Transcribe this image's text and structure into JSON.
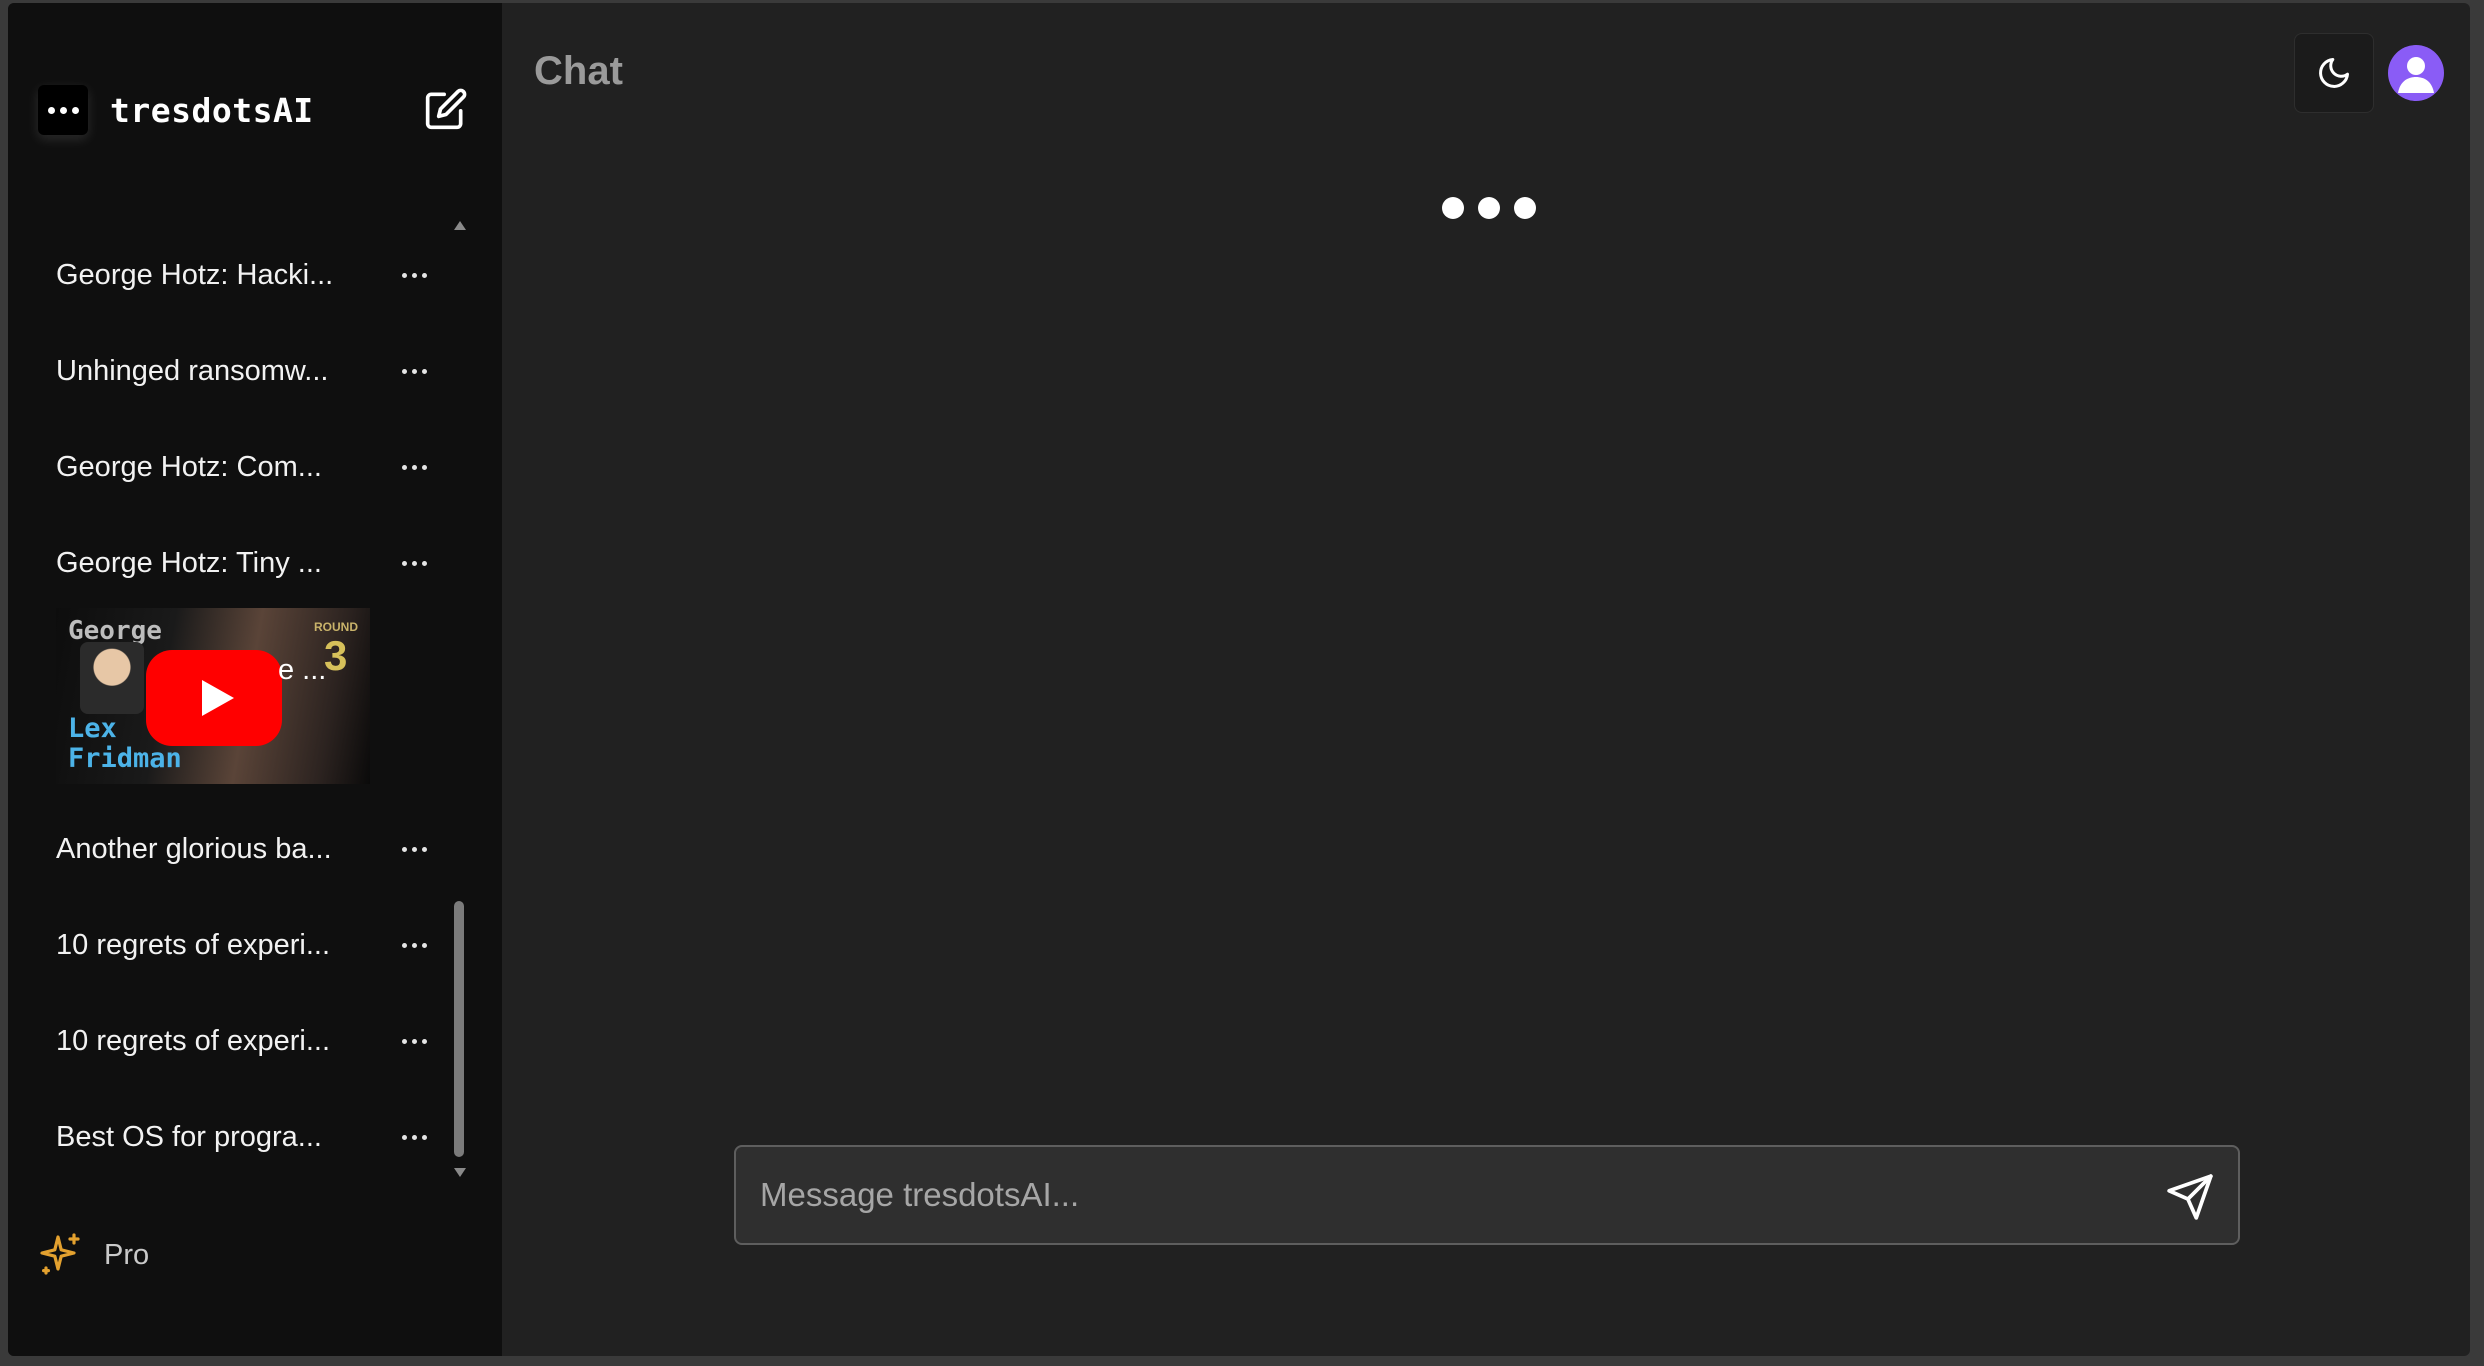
{
  "brand": {
    "name": "tresdotsAI",
    "logo_icon": "three-dots-logo-icon"
  },
  "sidebar": {
    "new_chat_icon": "edit-icon",
    "history": [
      {
        "label": "George Hotz: Hacki..."
      },
      {
        "label": "Unhinged ransomw..."
      },
      {
        "label": "George Hotz: Com..."
      },
      {
        "label": "George Hotz: Tiny ..."
      },
      {
        "label": "Another glorious ba..."
      },
      {
        "label": "10 regrets of experi..."
      },
      {
        "label": "10 regrets of experi..."
      },
      {
        "label": "Best OS for progra..."
      }
    ],
    "video_thumbnail": {
      "text_top": "George",
      "text_bottom": "Lex Fridman",
      "badge_small": "ROUND",
      "badge_number": "3",
      "overlay_text": "e ...",
      "icon": "youtube-play-icon"
    },
    "scroll": {
      "position_fraction": 0.35,
      "visible_fraction": 0.28
    },
    "pro": {
      "label": "Pro",
      "icon": "sparkles-icon"
    }
  },
  "main": {
    "title": "Chat",
    "theme_toggle_icon": "moon-icon",
    "avatar_icon": "user-avatar-icon",
    "typing_indicator_icon": "typing-dots-icon",
    "composer": {
      "placeholder": "Message tresdotsAI...",
      "send_icon": "send-icon"
    }
  },
  "colors": {
    "sidebar_bg": "#0f0f0f",
    "main_bg": "#212121",
    "accent_pro": "#e3a12f",
    "avatar": "#8a5cf6",
    "youtube_red": "#ff0000"
  }
}
